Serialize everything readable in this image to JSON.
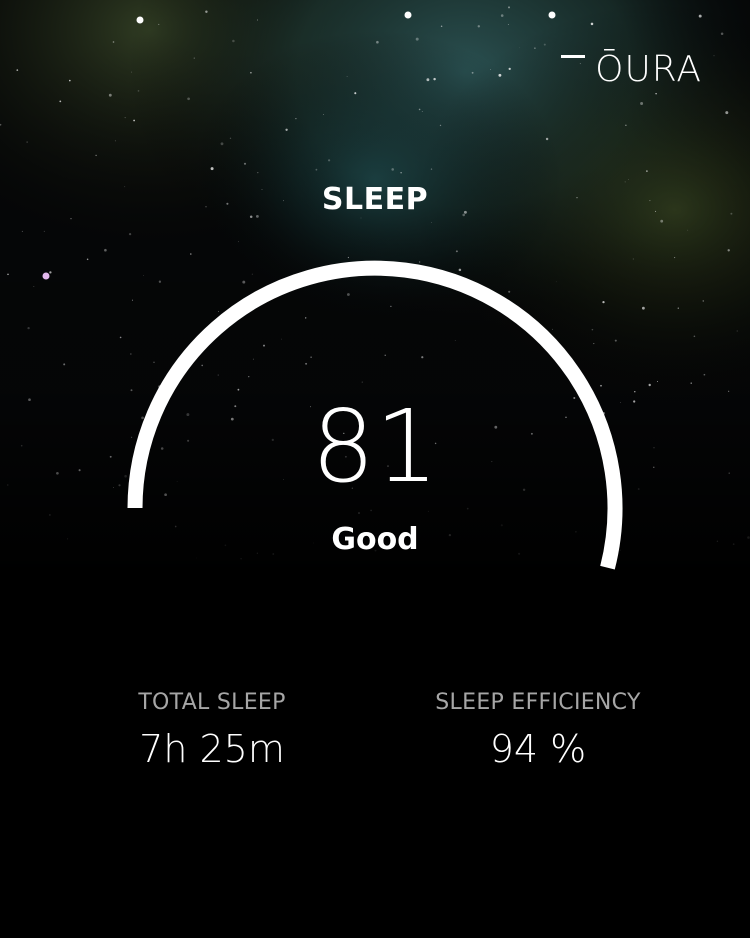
{
  "brand": {
    "logo_text": "ŌURA"
  },
  "score": {
    "title": "SLEEP",
    "value": "81",
    "rating": "Good",
    "max": 100
  },
  "stats": [
    {
      "label": "TOTAL SLEEP",
      "value": "7h 25m"
    },
    {
      "label": "SLEEP EFFICIENCY",
      "value": "94 %"
    }
  ],
  "colors": {
    "background": "#000000",
    "text": "#ffffff",
    "muted": "#a6a6a6",
    "arc": "#ffffff"
  }
}
